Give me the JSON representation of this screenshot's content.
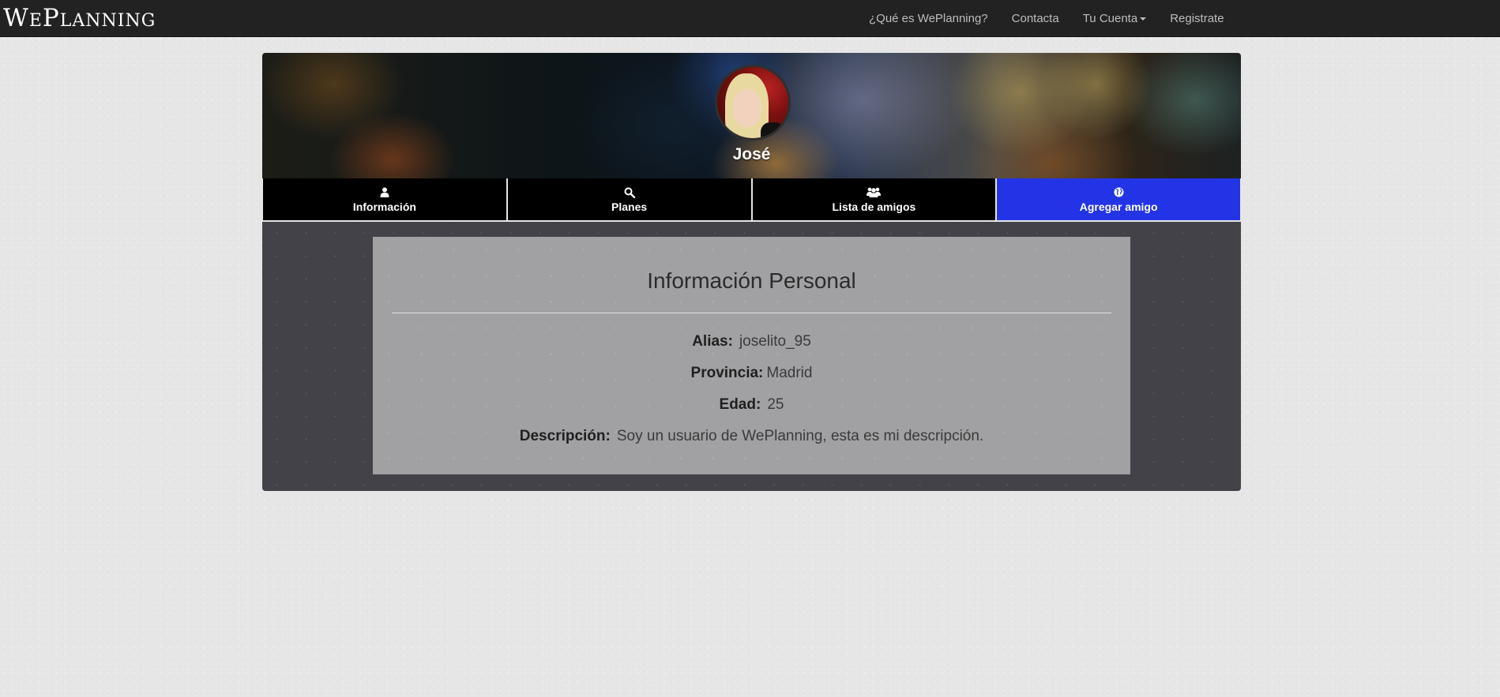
{
  "navbar": {
    "brand": "WePlanning",
    "links": {
      "about": "¿Qué es WePlanning?",
      "contact": "Contacta",
      "account": "Tu Cuenta",
      "register": "Registrate"
    }
  },
  "profile": {
    "name": "José"
  },
  "tabs": {
    "info": "Información",
    "plans": "Planes",
    "friends": "Lista de amigos",
    "add_friend": "Agregar amigo"
  },
  "active_tab": "add_friend",
  "colors": {
    "active_tab": "#2334e6",
    "navbar": "#222222",
    "panel": "#434248",
    "info_box": "#a1a1a4"
  },
  "info": {
    "title": "Información Personal",
    "alias_label": "Alias:",
    "alias_value": "joselito_95",
    "province_label": "Provincia:",
    "province_value": "Madrid",
    "age_label": "Edad:",
    "age_value": "25",
    "description_label": "Descripción:",
    "description_value": "Soy un usuario de WePlanning, esta es mi descripción."
  },
  "icons": {
    "info": "user-icon",
    "plans": "search-icon",
    "friends": "users-icon",
    "add_friend": "globe-icon"
  }
}
